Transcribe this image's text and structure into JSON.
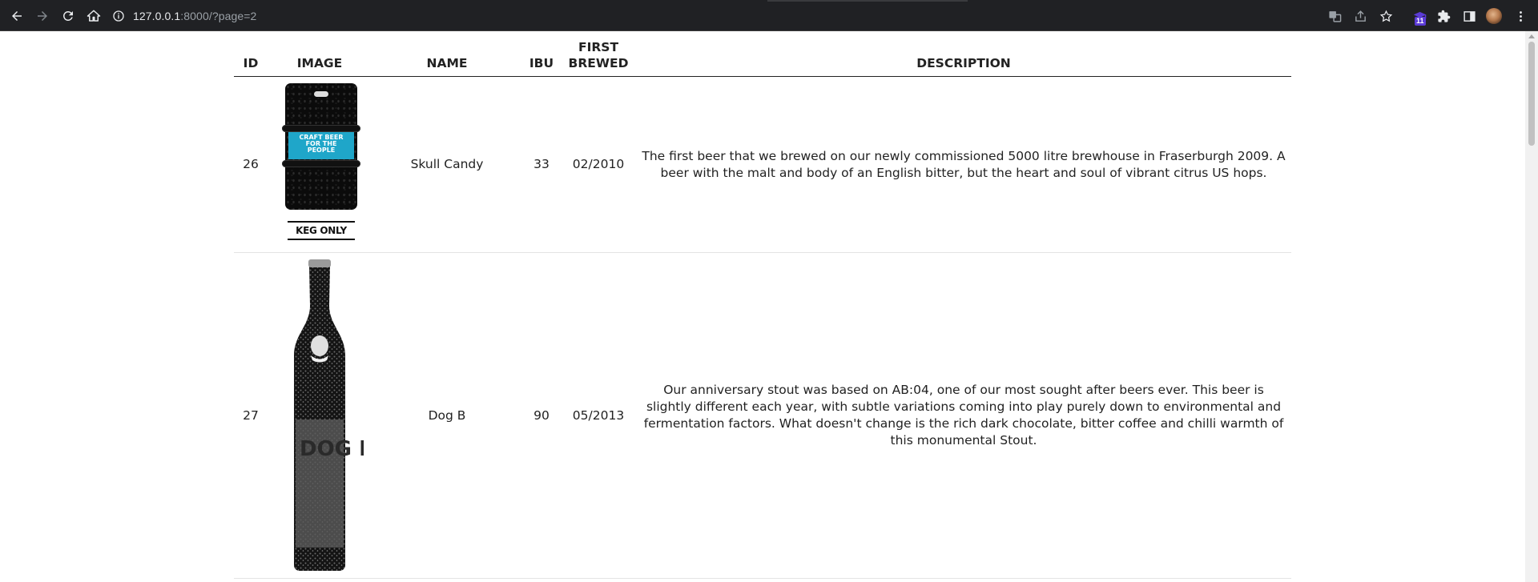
{
  "browser": {
    "url_host": "127.0.0.1",
    "url_rest": ":8000/?page=2",
    "extension_badge": "11"
  },
  "table": {
    "headers": {
      "id": "ID",
      "image": "IMAGE",
      "name": "NAME",
      "ibu": "IBU",
      "first_brewed": "FIRST BREWED",
      "description": "DESCRIPTION"
    },
    "rows": [
      {
        "id": "26",
        "image": {
          "type": "keg",
          "label": "CRAFT BEER FOR THE PEOPLE",
          "caption": "KEG ONLY"
        },
        "name": "Skull Candy",
        "ibu": "33",
        "first_brewed": "02/2010",
        "description": "The first beer that we brewed on our newly commissioned 5000 litre brewhouse in Fraserburgh 2009. A beer with the malt and body of an English bitter, but the heart and soul of vibrant citrus US hops."
      },
      {
        "id": "27",
        "image": {
          "type": "bottle",
          "label": "DOG B"
        },
        "name": "Dog B",
        "ibu": "90",
        "first_brewed": "05/2013",
        "description": "Our anniversary stout was based on AB:04, one of our most sought after beers ever. This beer is slightly different each year, with subtle variations coming into play purely down to environmental and fermentation factors. What doesn't change is the rich dark chocolate, bitter coffee and chilli warmth of this monumental Stout."
      }
    ]
  }
}
